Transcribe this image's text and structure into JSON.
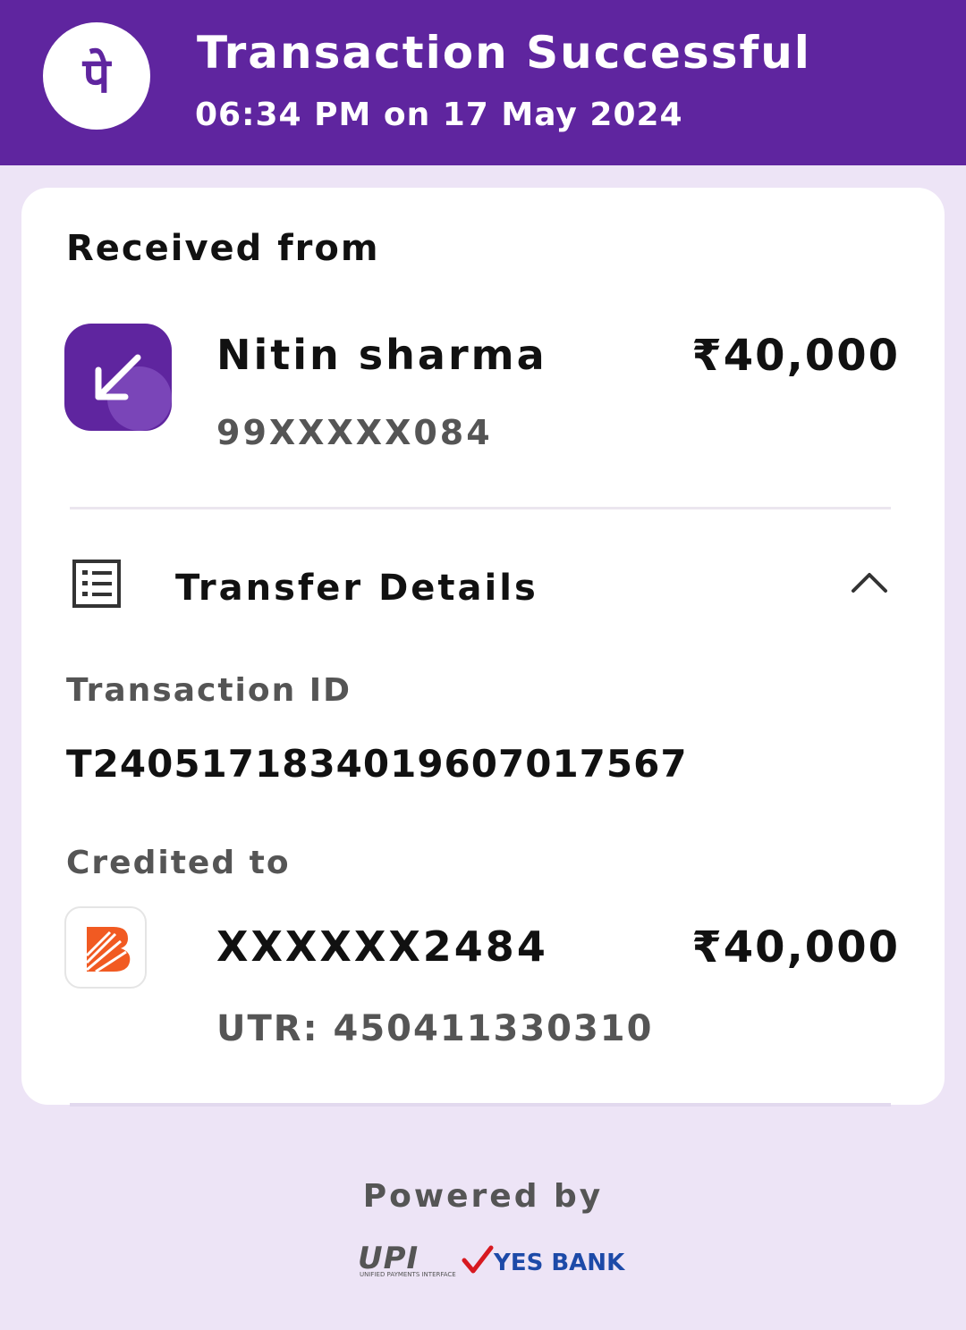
{
  "header": {
    "title": "Transaction Successful",
    "datetime": "06:34 PM on 17 May 2024",
    "logo_glyph": "पे",
    "color": "#5f259f"
  },
  "received": {
    "label": "Received from",
    "name": "Nitin sharma",
    "phone": "99XXXXX084",
    "amount": "₹40,000",
    "icon": "arrow-down-left-icon"
  },
  "transfer_details": {
    "title": "Transfer Details",
    "icon": "receipt-list-icon",
    "toggle_icon": "chevron-up-icon",
    "transaction_id_label": "Transaction ID",
    "transaction_id": "T2405171834019607017567",
    "credited_label": "Credited to",
    "account": "XXXXXX2484",
    "amount": "₹40,000",
    "utr": "UTR: 450411330310",
    "bank_icon": "bank-of-baroda-logo-icon"
  },
  "footer": {
    "powered_by": "Powered by",
    "upi_text": "UPI",
    "upi_caption": "UNIFIED PAYMENTS INTERFACE",
    "bank_text": "YES BANK"
  },
  "colors": {
    "background": "#ede4f6",
    "accent": "#5f259f",
    "bank_orange": "#f15a22"
  }
}
